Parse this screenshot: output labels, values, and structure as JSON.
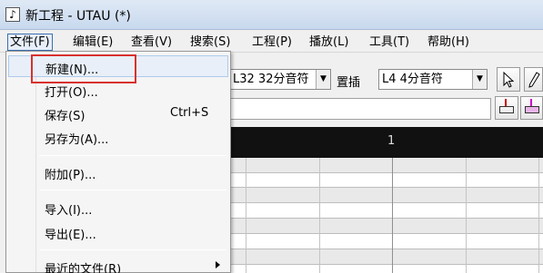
{
  "window": {
    "title": "新工程 - UTAU (*)",
    "icon": "music-note-icon"
  },
  "menubar": {
    "items": [
      {
        "label": "文件(F)"
      },
      {
        "label": "编辑(E)"
      },
      {
        "label": "查看(V)"
      },
      {
        "label": "搜索(S)"
      },
      {
        "label": "工程(P)"
      },
      {
        "label": "播放(L)"
      },
      {
        "label": "工具(T)"
      },
      {
        "label": "帮助(H)"
      }
    ]
  },
  "toolbar": {
    "note_length_value": "L32 32分音符",
    "insert_label": "置插",
    "insert_length_value": "L4  4分音符",
    "pointer_tool_icon": "cursor-arrow-icon",
    "pencil_tool_icon": "pencil-icon"
  },
  "piano_roll": {
    "measure_label": "1"
  },
  "file_menu": {
    "items": [
      {
        "label": "新建(N)...",
        "shortcut": ""
      },
      {
        "label": "打开(O)...",
        "shortcut": ""
      },
      {
        "label": "保存(S)",
        "shortcut": "Ctrl+S"
      },
      {
        "label": "另存为(A)...",
        "shortcut": ""
      },
      {
        "label": "附加(P)...",
        "shortcut": ""
      },
      {
        "label": "导入(I)...",
        "shortcut": ""
      },
      {
        "label": "导出(E)...",
        "shortcut": ""
      },
      {
        "label": "最近的文件(R)",
        "shortcut": ""
      }
    ]
  },
  "colors": {
    "annotation": "#d9302d",
    "menu_highlight": "#e8eff8",
    "roll_header": "#111111"
  }
}
